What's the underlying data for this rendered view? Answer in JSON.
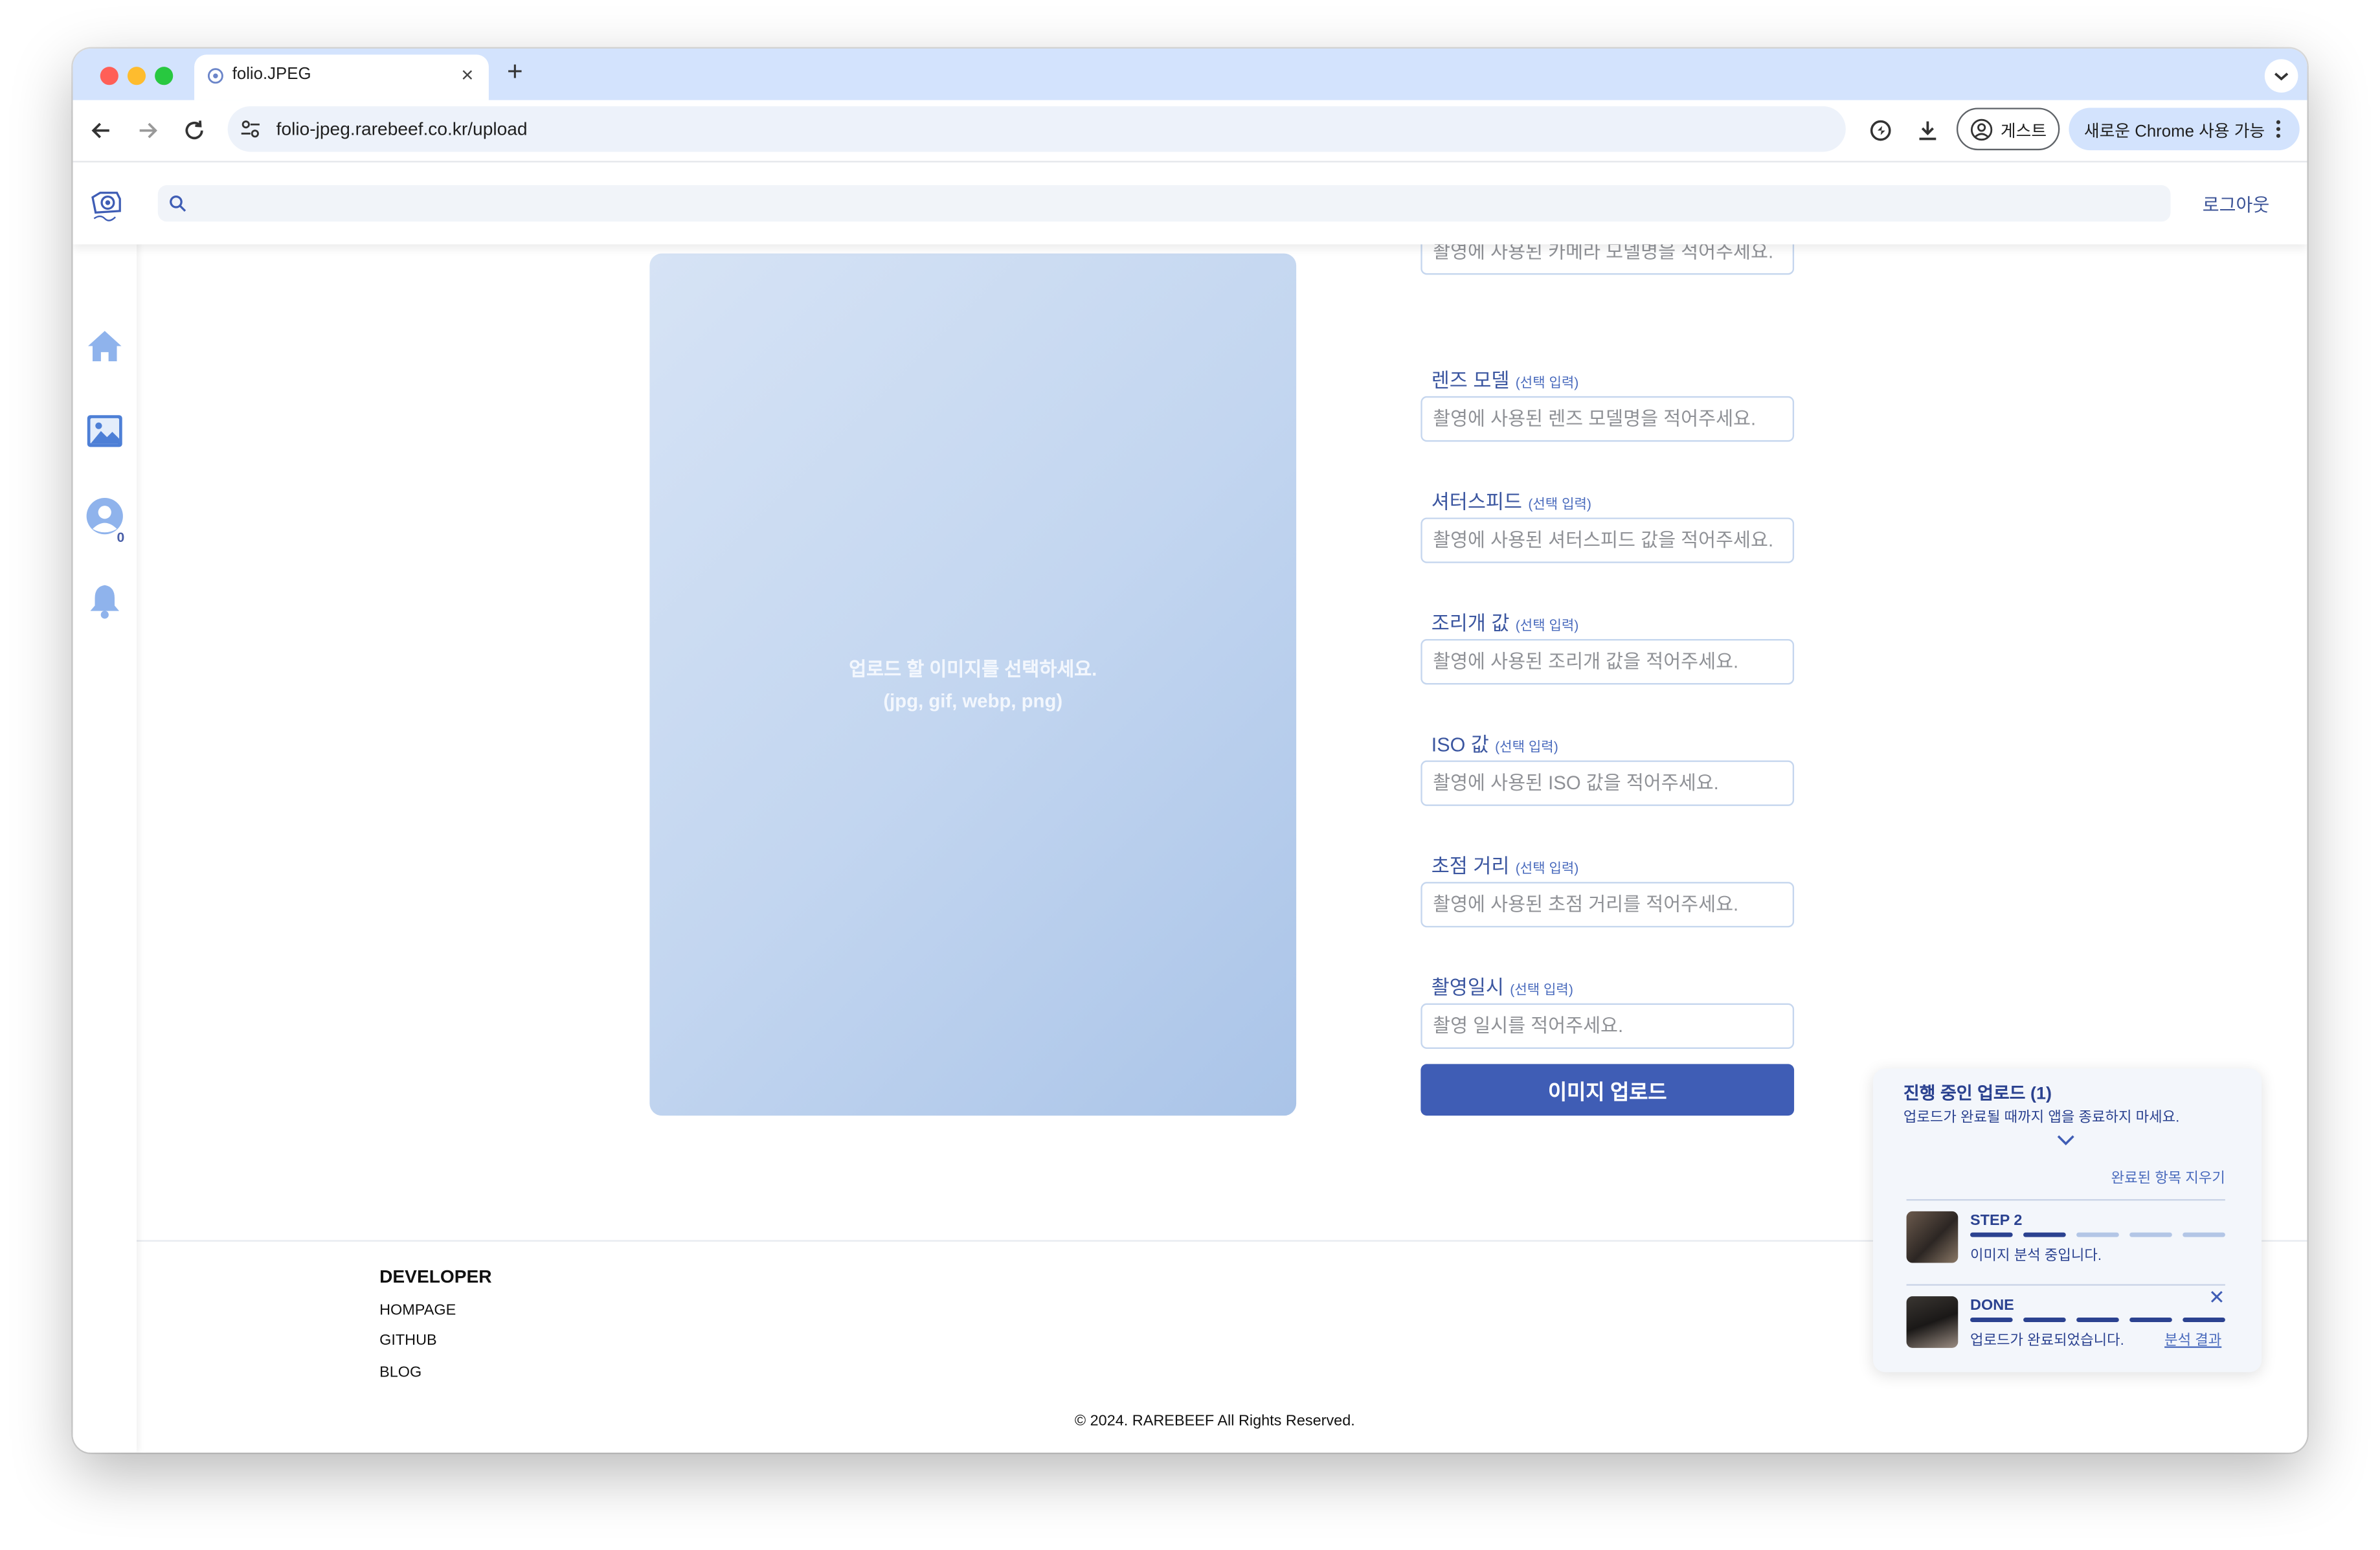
{
  "browser": {
    "tab_title": "folio.JPEG",
    "url": "folio-jpeg.rarebeef.co.kr/upload",
    "guest_label": "게스트",
    "update_label": "새로운 Chrome 사용 가능"
  },
  "header": {
    "logout_label": "로그아웃",
    "search_value": ""
  },
  "sidebar": {
    "notification_count": "0",
    "icons": [
      "home-icon",
      "gallery-icon",
      "profile-icon",
      "bell-icon"
    ]
  },
  "preview": {
    "line1": "업로드 할 이미지를 선택하세요.",
    "line2": "(jpg, gif, webp, png)"
  },
  "form": {
    "optional_tag": "(선택 입력)",
    "camera_placeholder": "촬영에 사용된 카메라 모델명을 적어주세요.",
    "fields": [
      {
        "label": "렌즈 모델",
        "placeholder": "촬영에 사용된 렌즈 모델명을 적어주세요."
      },
      {
        "label": "셔터스피드",
        "placeholder": "촬영에 사용된 셔터스피드 값을 적어주세요."
      },
      {
        "label": "조리개 값",
        "placeholder": "촬영에 사용된 조리개 값을 적어주세요."
      },
      {
        "label": "ISO 값",
        "placeholder": "촬영에 사용된 ISO 값을 적어주세요."
      },
      {
        "label": "초점 거리",
        "placeholder": "촬영에 사용된 초점 거리를 적어주세요."
      },
      {
        "label": "촬영일시",
        "placeholder": "촬영 일시를 적어주세요."
      }
    ],
    "submit_label": "이미지 업로드"
  },
  "footer": {
    "heading": "DEVELOPER",
    "links": [
      "HOMPAGE",
      "GITHUB",
      "BLOG"
    ],
    "copyright": "© 2024. RAREBEEF All Rights Reserved."
  },
  "upload_panel": {
    "title": "진행 중인 업로드 (1)",
    "subtitle": "업로드가 완료될 때까지 앱을 종료하지 마세요.",
    "clear_label": "완료된 항목 지우기",
    "jobs": [
      {
        "step": "STEP 2",
        "message": "이미지 분석 중입니다.",
        "progress_steps": 2,
        "total_steps": 5
      },
      {
        "step": "DONE",
        "message": "업로드가 완료되었습니다.",
        "link": "분석 결과",
        "progress_steps": 5,
        "total_steps": 5
      }
    ]
  },
  "colors": {
    "accent": "#3f5db5",
    "label_blue": "#3b56a0",
    "progress_done": "#2b4290",
    "progress_pending": "#b3c6e6"
  }
}
